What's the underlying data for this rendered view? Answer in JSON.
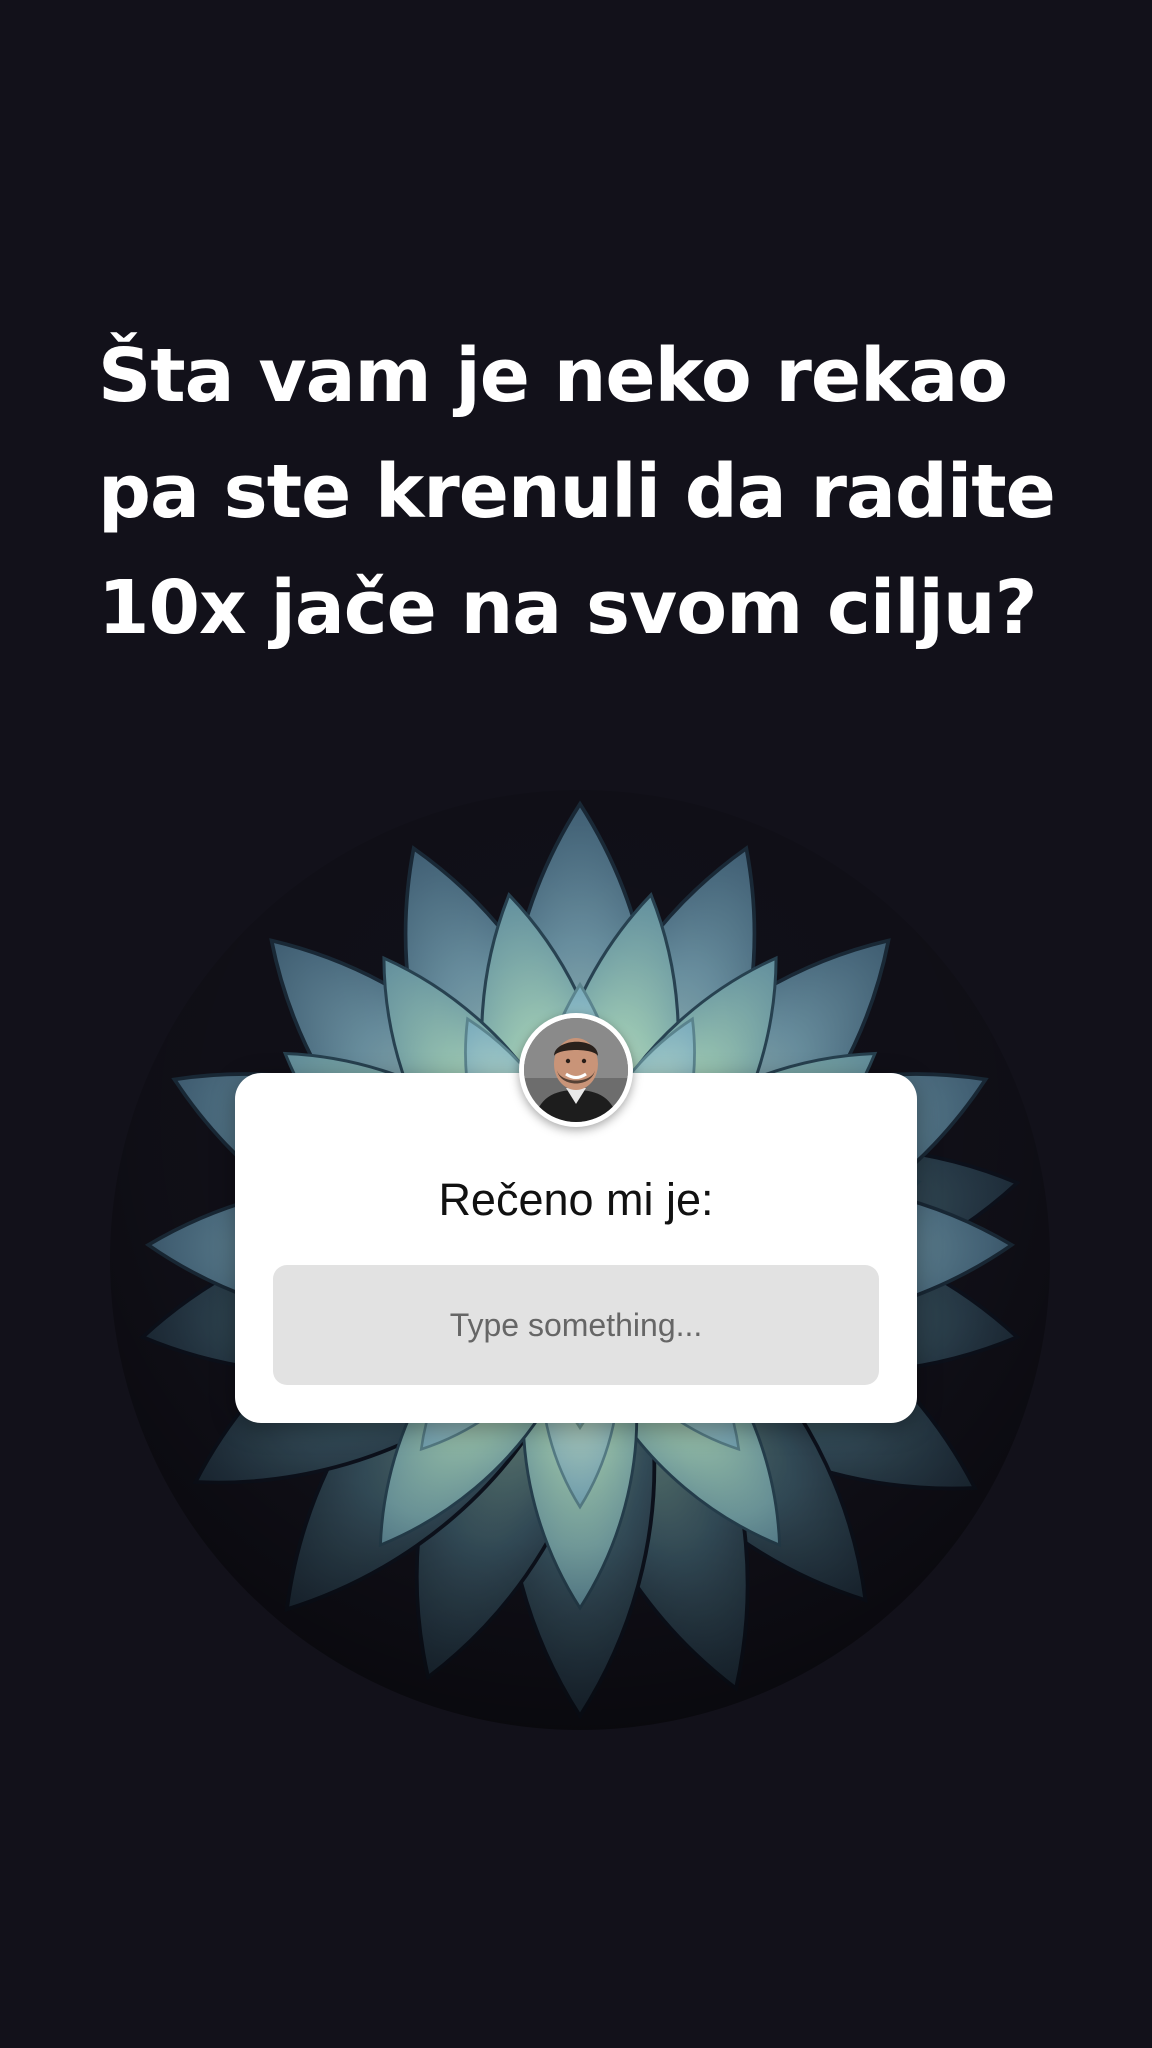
{
  "story": {
    "headline_lines": [
      "Šta vam je neko rekao",
      "pa ste krenuli da radite",
      "10x jače na svom cilju?"
    ],
    "background_color": "#12111a",
    "background_image": "dahlia-flower"
  },
  "question_sticker": {
    "avatar_icon": "profile-photo-avatar",
    "label": "Rečeno mi je:",
    "input_placeholder": "Type something...",
    "card_color": "#ffffff",
    "input_color": "#e2e2e2"
  }
}
